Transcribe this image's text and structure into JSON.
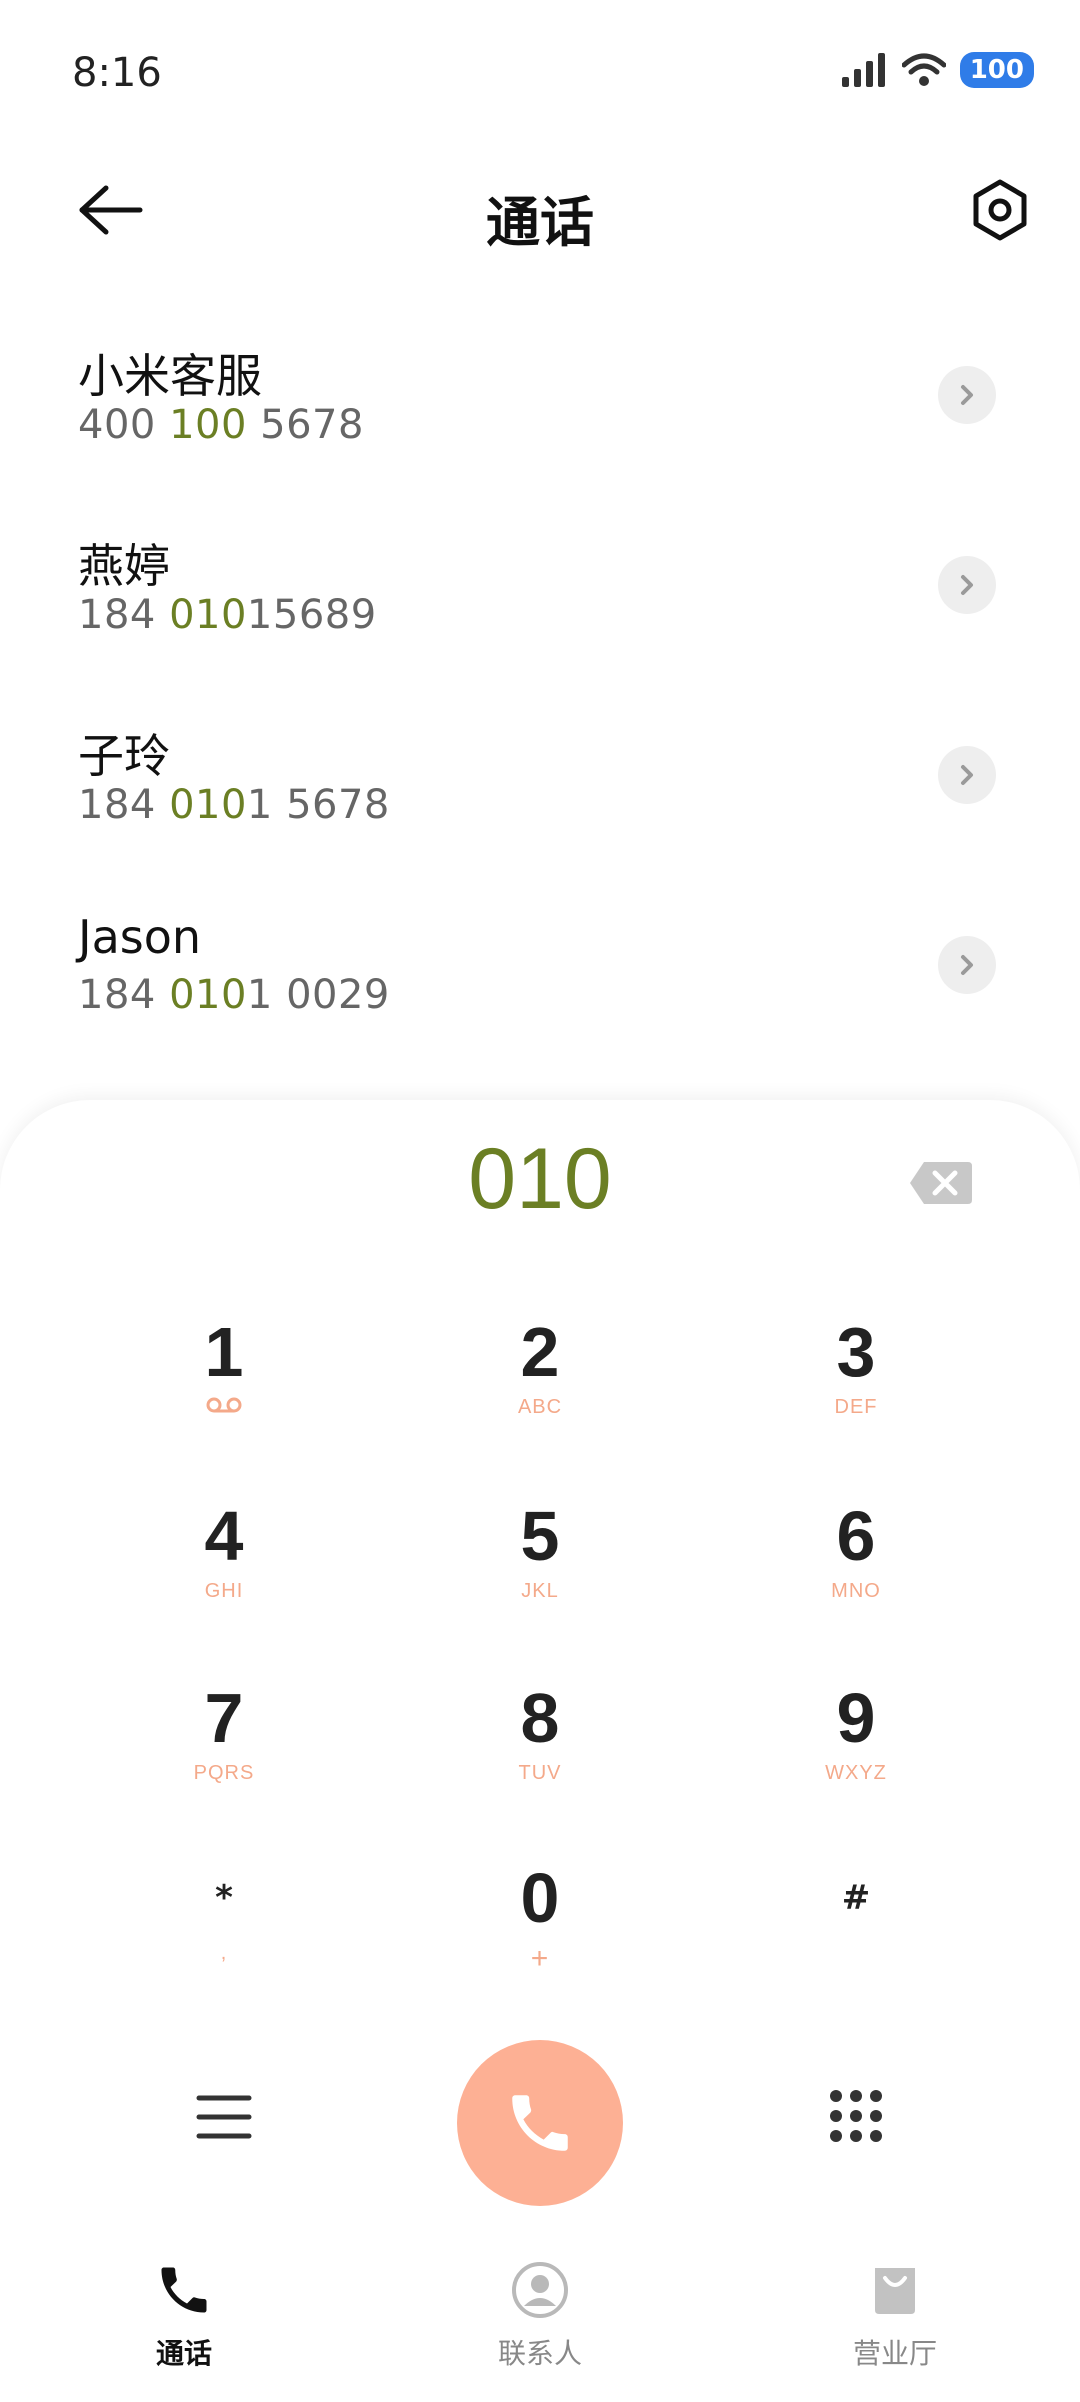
{
  "status": {
    "time": "8:16",
    "battery": "100"
  },
  "header": {
    "title": "通话"
  },
  "results": [
    {
      "name": "小米客服",
      "phone_parts": [
        "400 ",
        "100",
        " 5678"
      ],
      "highlight": [
        false,
        true,
        false
      ]
    },
    {
      "name": "燕婷",
      "phone_parts": [
        "184 ",
        "010",
        "15689"
      ],
      "highlight": [
        false,
        true,
        false
      ]
    },
    {
      "name": "子玲",
      "phone_parts": [
        "184 ",
        "010",
        "1 5678"
      ],
      "highlight": [
        false,
        true,
        false
      ]
    },
    {
      "name": "Jason",
      "phone_parts": [
        "184 ",
        "010",
        "1 0029"
      ],
      "highlight": [
        false,
        true,
        false
      ]
    }
  ],
  "dial": {
    "number": "010",
    "keys": [
      {
        "digit": "1",
        "letters": "voicemail-icon"
      },
      {
        "digit": "2",
        "letters": "ABC"
      },
      {
        "digit": "3",
        "letters": "DEF"
      },
      {
        "digit": "4",
        "letters": "GHI"
      },
      {
        "digit": "5",
        "letters": "JKL"
      },
      {
        "digit": "6",
        "letters": "MNO"
      },
      {
        "digit": "7",
        "letters": "PQRS"
      },
      {
        "digit": "8",
        "letters": "TUV"
      },
      {
        "digit": "9",
        "letters": "WXYZ"
      },
      {
        "digit": "*",
        "letters": ","
      },
      {
        "digit": "0",
        "letters": "+"
      },
      {
        "digit": "#",
        "letters": ""
      }
    ]
  },
  "nav": {
    "calls": "通话",
    "contacts": "联系人",
    "store": "营业厅"
  },
  "colors": {
    "accent": "#6b7f24",
    "call_button": "#fdb094",
    "key_letters": "#f4a98a",
    "battery": "#2f7ce8"
  }
}
